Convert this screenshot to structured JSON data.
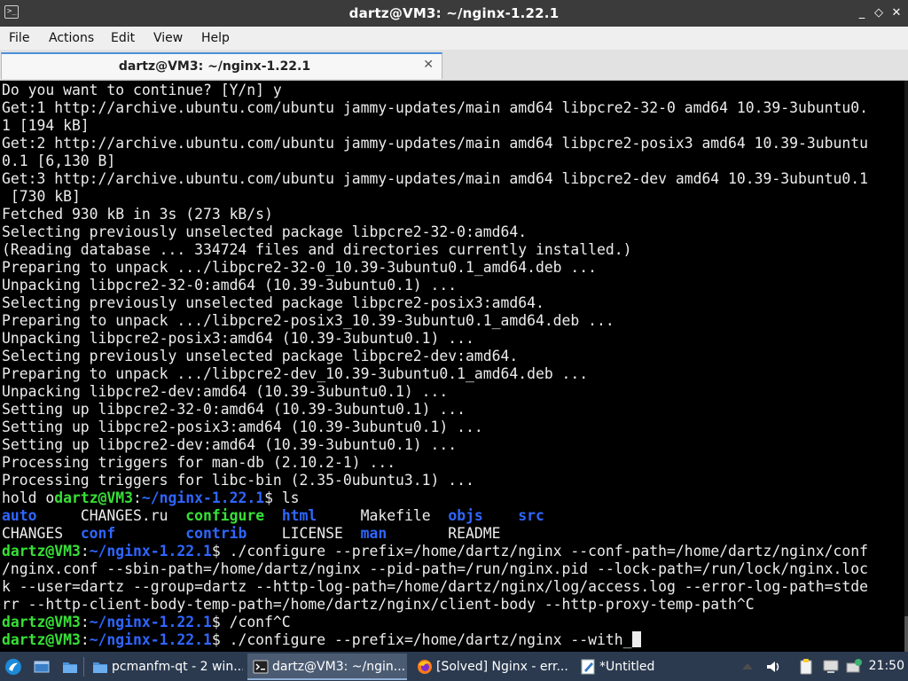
{
  "window": {
    "title": "dartz@VM3: ~/nginx-1.22.1",
    "app_icon_glyph": ">_",
    "minimize_glyph": "_",
    "maximize_glyph": "◇",
    "close_glyph": "✕"
  },
  "menu": {
    "items": [
      "File",
      "Actions",
      "Edit",
      "View",
      "Help"
    ]
  },
  "tabs": [
    {
      "label": "dartz@VM3: ~/nginx-1.22.1",
      "close_glyph": "✕"
    }
  ],
  "terminal": {
    "colors": {
      "background": "#000000",
      "text": "#ececec",
      "prompt_green": "#37e037",
      "dir_blue": "#2f66ff"
    },
    "lines": [
      [
        {
          "t": "Do you want to continue? [Y/n] y",
          "c": "plain"
        }
      ],
      [
        {
          "t": "Get:1 http://archive.ubuntu.com/ubuntu jammy-updates/main amd64 libpcre2-32-0 amd64 10.39-3ubuntu0.",
          "c": "plain"
        }
      ],
      [
        {
          "t": "1 [194 kB]",
          "c": "plain"
        }
      ],
      [
        {
          "t": "Get:2 http://archive.ubuntu.com/ubuntu jammy-updates/main amd64 libpcre2-posix3 amd64 10.39-3ubuntu",
          "c": "plain"
        }
      ],
      [
        {
          "t": "0.1 [6,130 B]",
          "c": "plain"
        }
      ],
      [
        {
          "t": "Get:3 http://archive.ubuntu.com/ubuntu jammy-updates/main amd64 libpcre2-dev amd64 10.39-3ubuntu0.1",
          "c": "plain"
        }
      ],
      [
        {
          "t": " [730 kB]",
          "c": "plain"
        }
      ],
      [
        {
          "t": "Fetched 930 kB in 3s (273 kB/s)",
          "c": "plain"
        }
      ],
      [
        {
          "t": "Selecting previously unselected package libpcre2-32-0:amd64.",
          "c": "plain"
        }
      ],
      [
        {
          "t": "(Reading database ... 334724 files and directories currently installed.)",
          "c": "plain"
        }
      ],
      [
        {
          "t": "Preparing to unpack .../libpcre2-32-0_10.39-3ubuntu0.1_amd64.deb ...",
          "c": "plain"
        }
      ],
      [
        {
          "t": "Unpacking libpcre2-32-0:amd64 (10.39-3ubuntu0.1) ...",
          "c": "plain"
        }
      ],
      [
        {
          "t": "Selecting previously unselected package libpcre2-posix3:amd64.",
          "c": "plain"
        }
      ],
      [
        {
          "t": "Preparing to unpack .../libpcre2-posix3_10.39-3ubuntu0.1_amd64.deb ...",
          "c": "plain"
        }
      ],
      [
        {
          "t": "Unpacking libpcre2-posix3:amd64 (10.39-3ubuntu0.1) ...",
          "c": "plain"
        }
      ],
      [
        {
          "t": "Selecting previously unselected package libpcre2-dev:amd64.",
          "c": "plain"
        }
      ],
      [
        {
          "t": "Preparing to unpack .../libpcre2-dev_10.39-3ubuntu0.1_amd64.deb ...",
          "c": "plain"
        }
      ],
      [
        {
          "t": "Unpacking libpcre2-dev:amd64 (10.39-3ubuntu0.1) ...",
          "c": "plain"
        }
      ],
      [
        {
          "t": "Setting up libpcre2-32-0:amd64 (10.39-3ubuntu0.1) ...",
          "c": "plain"
        }
      ],
      [
        {
          "t": "Setting up libpcre2-posix3:amd64 (10.39-3ubuntu0.1) ...",
          "c": "plain"
        }
      ],
      [
        {
          "t": "Setting up libpcre2-dev:amd64 (10.39-3ubuntu0.1) ...",
          "c": "plain"
        }
      ],
      [
        {
          "t": "Processing triggers for man-db (2.10.2-1) ...",
          "c": "plain"
        }
      ],
      [
        {
          "t": "Processing triggers for libc-bin (2.35-0ubuntu3.1) ...",
          "c": "plain"
        }
      ],
      [
        {
          "t": "hold o",
          "c": "plain"
        },
        {
          "t": "dartz@VM3",
          "c": "green"
        },
        {
          "t": ":",
          "c": "plain"
        },
        {
          "t": "~/nginx-1.22.1",
          "c": "blue"
        },
        {
          "t": "$ ls",
          "c": "plain"
        }
      ],
      [
        {
          "t": "auto",
          "c": "blue"
        },
        {
          "t": "     CHANGES.ru  ",
          "c": "plain"
        },
        {
          "t": "configure",
          "c": "green"
        },
        {
          "t": "  ",
          "c": "plain"
        },
        {
          "t": "html",
          "c": "blue"
        },
        {
          "t": "     Makefile  ",
          "c": "plain"
        },
        {
          "t": "objs",
          "c": "blue"
        },
        {
          "t": "    ",
          "c": "plain"
        },
        {
          "t": "src",
          "c": "blue"
        }
      ],
      [
        {
          "t": "CHANGES  ",
          "c": "plain"
        },
        {
          "t": "conf",
          "c": "blue"
        },
        {
          "t": "        ",
          "c": "plain"
        },
        {
          "t": "contrib",
          "c": "blue"
        },
        {
          "t": "    LICENSE  ",
          "c": "plain"
        },
        {
          "t": "man",
          "c": "blue"
        },
        {
          "t": "       README",
          "c": "plain"
        }
      ],
      [
        {
          "t": "dartz@VM3",
          "c": "green"
        },
        {
          "t": ":",
          "c": "plain"
        },
        {
          "t": "~/nginx-1.22.1",
          "c": "blue"
        },
        {
          "t": "$ ./configure --prefix=/home/dartz/nginx --conf-path=/home/dartz/nginx/conf",
          "c": "plain"
        }
      ],
      [
        {
          "t": "/nginx.conf --sbin-path=/home/dartz/nginx --pid-path=/run/nginx.pid --lock-path=/run/lock/nginx.loc",
          "c": "plain"
        }
      ],
      [
        {
          "t": "k --user=dartz --group=dartz --http-log-path=/home/dartz/nginx/log/access.log --error-log-path=stde",
          "c": "plain"
        }
      ],
      [
        {
          "t": "rr --http-client-body-temp-path=/home/dartz/nginx/client-body --http-proxy-temp-path^C",
          "c": "plain"
        }
      ],
      [
        {
          "t": "dartz@VM3",
          "c": "green"
        },
        {
          "t": ":",
          "c": "plain"
        },
        {
          "t": "~/nginx-1.22.1",
          "c": "blue"
        },
        {
          "t": "$ /conf^C",
          "c": "plain"
        }
      ],
      [
        {
          "t": "dartz@VM3",
          "c": "green"
        },
        {
          "t": ":",
          "c": "plain"
        },
        {
          "t": "~/nginx-1.22.1",
          "c": "blue"
        },
        {
          "t": "$ ./configure --prefix=/home/dartz/nginx --with_",
          "c": "plain"
        },
        {
          "t": "",
          "c": "cursor"
        }
      ]
    ]
  },
  "taskbar": {
    "start_icon": "start-menu-icon",
    "tasks": [
      {
        "label": "pcmanfm-qt - 2 win...",
        "icon": "folder-icon",
        "active": false
      },
      {
        "label": "dartz@VM3: ~/ngin...",
        "icon": "terminal-icon",
        "active": true
      },
      {
        "label": "[Solved] Nginx - err...",
        "icon": "firefox-icon",
        "active": false
      },
      {
        "label": "*Untitled",
        "icon": "text-editor-icon",
        "active": false
      }
    ],
    "clock": "21:50"
  }
}
